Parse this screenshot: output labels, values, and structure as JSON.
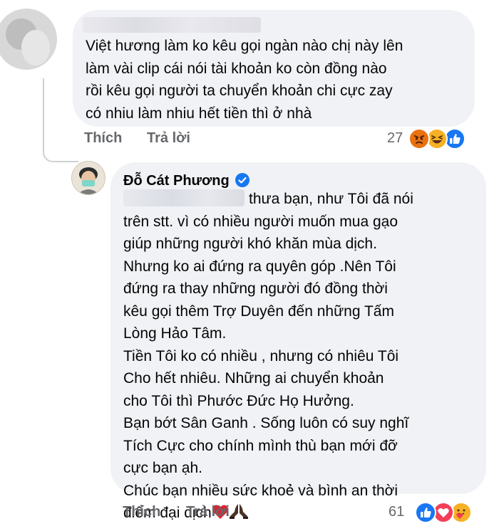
{
  "comment1": {
    "text": "Việt hương làm ko kêu gọi ngàn nào chị này lên\nlàm vài clip cái nói tài khoản ko còn đồng nào\nrồi kêu gọi người ta chuyển khoản chi cực zay\ncó nhiu làm nhiu hết tiền thì ở nhà",
    "like_label": "Thích",
    "reply_label": "Trả lời",
    "reaction_count": "27",
    "reactions": [
      "angry-icon",
      "haha-icon",
      "like-icon"
    ]
  },
  "reply": {
    "author": "Đỗ Cát Phương",
    "first_line": "thưa bạn, như Tôi đã nói",
    "text": "trên stt. vì có nhiều người muốn mua gạo\ngiúp những người khó khăn mùa dịch.\nNhưng ko ai đứng ra quyên góp .Nên Tôi\nđứng ra thay những người đó đồng thời\nkêu gọi thêm Trợ Duyên đến những Tấm\nLòng Hảo Tâm.\nTiền Tôi ko có nhiều , nhưng có nhiêu Tôi\nCho hết nhiêu. Những ai chuyển khoản\ncho Tôi thì Phước Đức Họ Hưởng.\nBạn bớt Sân Ganh . Sống luôn có suy nghĩ\nTích Cực cho chính mình thù bạn mới đỡ\ncực bạn ạh.\nChúc bạn nhiều sức khoẻ và bình an thời",
    "last_line": "điểm đại dịch",
    "emojis": [
      "red-heart-icon",
      "praying-hands-icon"
    ],
    "like_label": "Thích",
    "reply_label": "Trả lời",
    "reaction_count": "61",
    "reactions": [
      "like-icon",
      "love-icon",
      "care-icon"
    ]
  },
  "colors": {
    "bubble": "#f0f2f5",
    "meta_text": "#65676b",
    "like_blue": "#1877f2",
    "love_red": "#f33e58",
    "angry_orange": "#e9710f",
    "haha_yellow": "#f7b125"
  }
}
